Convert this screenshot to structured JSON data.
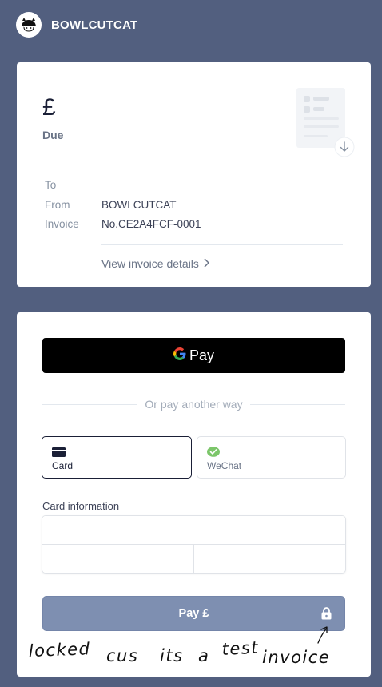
{
  "header": {
    "brand": "BOWLCUTCAT",
    "logo_icon": "bowlcutcat-logo"
  },
  "invoice": {
    "amount": "£",
    "due_label": "Due",
    "to_label": "To",
    "to_value": "",
    "from_label": "From",
    "from_value": "BOWLCUTCAT",
    "invoice_label": "Invoice",
    "invoice_value": "No.CE2A4FCF-0001",
    "details_link": "View invoice details",
    "illustration_icon": "invoice-download-icon"
  },
  "payment": {
    "gpay_label": "Pay",
    "gpay_icon": "google-g-icon",
    "divider_text": "Or pay another way",
    "methods": [
      {
        "label": "Card",
        "icon": "credit-card-icon",
        "selected": true
      },
      {
        "label": "WeChat",
        "icon": "wechat-icon",
        "selected": false
      }
    ],
    "card_info_label": "Card information",
    "card_number_placeholder": "",
    "expiry_placeholder": "",
    "cvc_placeholder": "",
    "pay_button_label": "Pay £",
    "pay_button_icon": "lock-icon"
  },
  "annotation": {
    "text": "locked cus its a test invoice"
  },
  "colors": {
    "background": "#525f7f",
    "card": "#ffffff",
    "pay_button": "#7e8fb1",
    "gpay": "#000000",
    "wechat_green": "#7cc66a"
  }
}
